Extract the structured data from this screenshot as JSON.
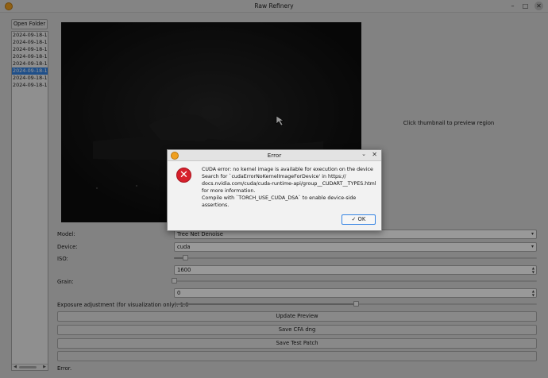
{
  "window": {
    "title": "Raw Refinery",
    "minimize_glyph": "–",
    "maximize_glyph": "□",
    "close_glyph": "✕"
  },
  "sidebar": {
    "open_folder_label": "Open Folder",
    "files": [
      {
        "name": "2024-09-18-17",
        "selected": false
      },
      {
        "name": "2024-09-18-17",
        "selected": false
      },
      {
        "name": "2024-09-18-18",
        "selected": false
      },
      {
        "name": "2024-09-18-18",
        "selected": false
      },
      {
        "name": "2024-09-18-18",
        "selected": false
      },
      {
        "name": "2024-09-18-18",
        "selected": true
      },
      {
        "name": "2024-09-18-19",
        "selected": false
      },
      {
        "name": "2024-09-18-19",
        "selected": false
      }
    ],
    "scroll_left": "◀",
    "scroll_right": "▶"
  },
  "preview": {
    "thumbnail_hint": "Click thumbnail to preview region"
  },
  "controls": {
    "model_label": "Model:",
    "model_value": "Tree Net Denoise",
    "device_label": "Device:",
    "device_value": "cuda",
    "iso_label": "ISO:",
    "iso_value": "1600",
    "iso_slider_fraction": 0.03,
    "grain_label": "Grain:",
    "grain_value": "0",
    "grain_slider_fraction": 0.0,
    "exposure_label": "Exposure adjustment (for visualization only): 1.0",
    "exposure_slider_fraction": 0.5,
    "combo_arrow": "▾",
    "spin_up": "▲",
    "spin_down": "▼"
  },
  "buttons": {
    "update_preview": "Update Preview",
    "save_cfa": "Save CFA dng",
    "save_test_patch": "Save Test Patch"
  },
  "status": {
    "text": "Error."
  },
  "dialog": {
    "title": "Error",
    "chevron": "⌄",
    "close": "✕",
    "error_glyph": "✕",
    "message_lines": [
      "CUDA error: no kernel image is available for execution on the device",
      "Search for `cudaErrorNoKernelImageForDevice' in https://",
      "docs.nvidia.com/cuda/cuda-runtime-api/group__CUDART__TYPES.html",
      "for more information.",
      "Compile with `TORCH_USE_CUDA_DSA` to enable device-side assertions."
    ],
    "ok_label": "✓ OK"
  },
  "colors": {
    "accent": "#3584e4",
    "error": "#d61f2b",
    "app_icon": "#f0a020"
  }
}
